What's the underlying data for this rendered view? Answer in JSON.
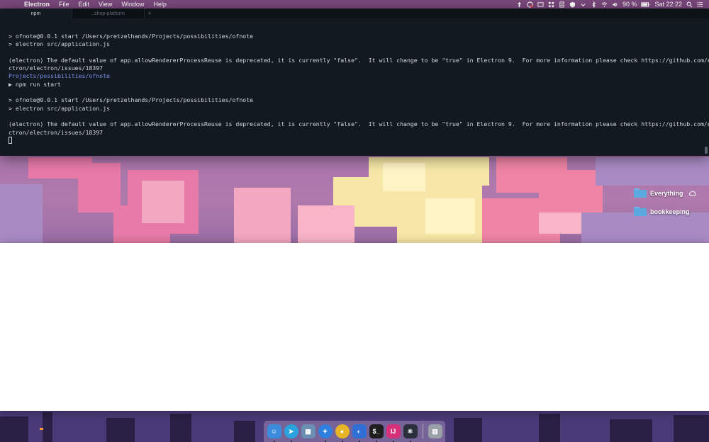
{
  "menubar": {
    "app_name": "Electron",
    "menus": [
      "File",
      "Edit",
      "View",
      "Window",
      "Help"
    ],
    "status": {
      "battery": "90 %",
      "clock": "Sat 22:22"
    }
  },
  "terminal": {
    "tabs": [
      {
        "label": "npm",
        "active": true
      },
      {
        "label": "..shop-platform",
        "active": false
      }
    ],
    "add_tab": "+",
    "lines": [
      {
        "text": "> ofnote@0.0.1 start /Users/pretzelhands/Projects/possibilities/ofnote",
        "kind": "normal"
      },
      {
        "text": "> electron src/application.js",
        "kind": "normal"
      },
      {
        "text": "",
        "kind": "blank"
      },
      {
        "text": "(electron) The default value of app.allowRendererProcessReuse is deprecated, it is currently \"false\".  It will change to be \"true\" in Electron 9.  For more information please check https://github.com/ele",
        "kind": "normal"
      },
      {
        "text": "ctron/electron/issues/18397",
        "kind": "normal"
      },
      {
        "text": "Projects/possibilities/ofnote",
        "kind": "path"
      },
      {
        "text": "▶ npm run start",
        "kind": "normal"
      },
      {
        "text": "",
        "kind": "blank"
      },
      {
        "text": "> ofnote@0.0.1 start /Users/pretzelhands/Projects/possibilities/ofnote",
        "kind": "normal"
      },
      {
        "text": "> electron src/application.js",
        "kind": "normal"
      },
      {
        "text": "",
        "kind": "blank"
      },
      {
        "text": "(electron) The default value of app.allowRendererProcessReuse is deprecated, it is currently \"false\".  It will change to be \"true\" in Electron 9.  For more information please check https://github.com/ele",
        "kind": "normal"
      },
      {
        "text": "ctron/electron/issues/18397",
        "kind": "normal"
      }
    ]
  },
  "desktop": {
    "icons": [
      {
        "label": "Everything",
        "icon": "folder-icon",
        "badge": "cloud-icon"
      },
      {
        "label": "bookkeeping",
        "icon": "folder-icon"
      }
    ]
  },
  "dock": {
    "apps": [
      {
        "name": "finder-icon",
        "color": "#3d8bdc"
      },
      {
        "name": "telegram-icon",
        "color": "#2aa3de"
      },
      {
        "name": "preview-icon",
        "color": "#6b8fb3"
      },
      {
        "name": "safari-icon",
        "color": "#2f7fe0"
      },
      {
        "name": "chrome-icon",
        "color": "#e6b425"
      },
      {
        "name": "firefox-icon",
        "color": "#2f6fd6"
      },
      {
        "name": "terminal-icon",
        "color": "#1e1e1e"
      },
      {
        "name": "intellij-icon",
        "color": "#d6307a"
      },
      {
        "name": "electron-icon",
        "color": "#2b2e3b"
      },
      {
        "name": "trash-icon",
        "color": "#9aa0a8"
      }
    ]
  },
  "colors": {
    "terminal_bg": "#121920",
    "terminal_text": "#d3d8de",
    "terminal_path": "#7d8ff0",
    "menubar_bg": "#784678"
  }
}
